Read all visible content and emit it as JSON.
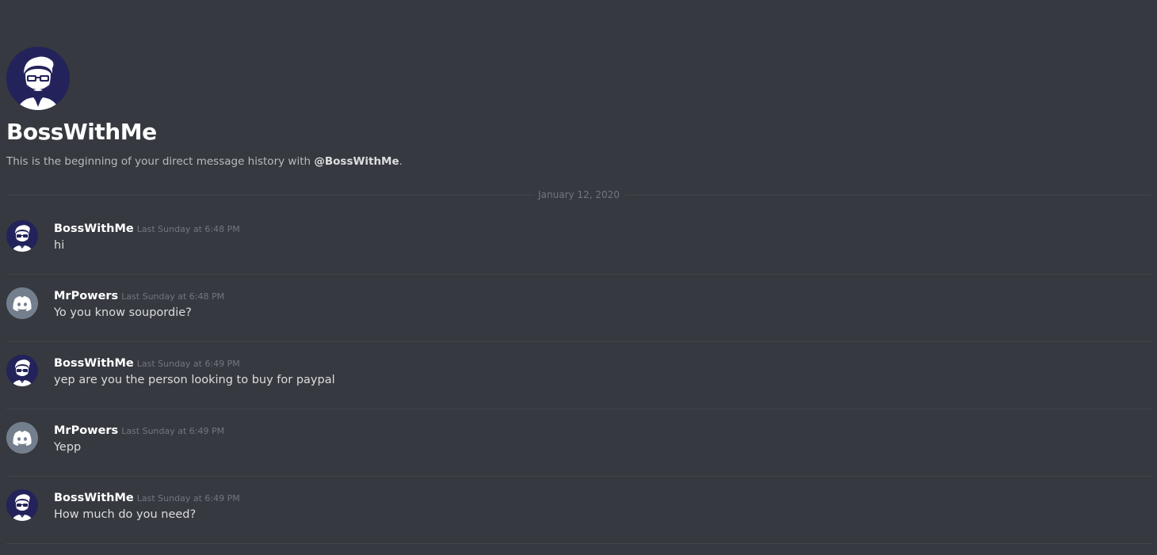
{
  "intro": {
    "avatar_icon": "bearded-man-glasses-icon",
    "title": "BossWithMe",
    "desc_prefix": "This is the beginning of your direct message history with ",
    "mention": "@BossWithMe",
    "desc_suffix": "."
  },
  "divider": {
    "date": "January 12, 2020"
  },
  "colors": {
    "background": "#36393f",
    "boss_avatar": "#23225a",
    "discord_avatar": "#747f8d"
  },
  "messages": [
    {
      "author": "BossWithMe",
      "time": "Last Sunday at 6:48 PM",
      "text": "hi",
      "avatar_icon": "bearded-man-glasses-icon"
    },
    {
      "author": "MrPowers",
      "time": "Last Sunday at 6:48 PM",
      "text": "Yo you know soupordie?",
      "avatar_icon": "discord-logo-icon"
    },
    {
      "author": "BossWithMe",
      "time": "Last Sunday at 6:49 PM",
      "text": "yep are you the person looking to buy for paypal",
      "avatar_icon": "bearded-man-glasses-icon"
    },
    {
      "author": "MrPowers",
      "time": "Last Sunday at 6:49 PM",
      "text": "Yepp",
      "avatar_icon": "discord-logo-icon"
    },
    {
      "author": "BossWithMe",
      "time": "Last Sunday at 6:49 PM",
      "text": "How much do you need?",
      "avatar_icon": "bearded-man-glasses-icon"
    }
  ]
}
